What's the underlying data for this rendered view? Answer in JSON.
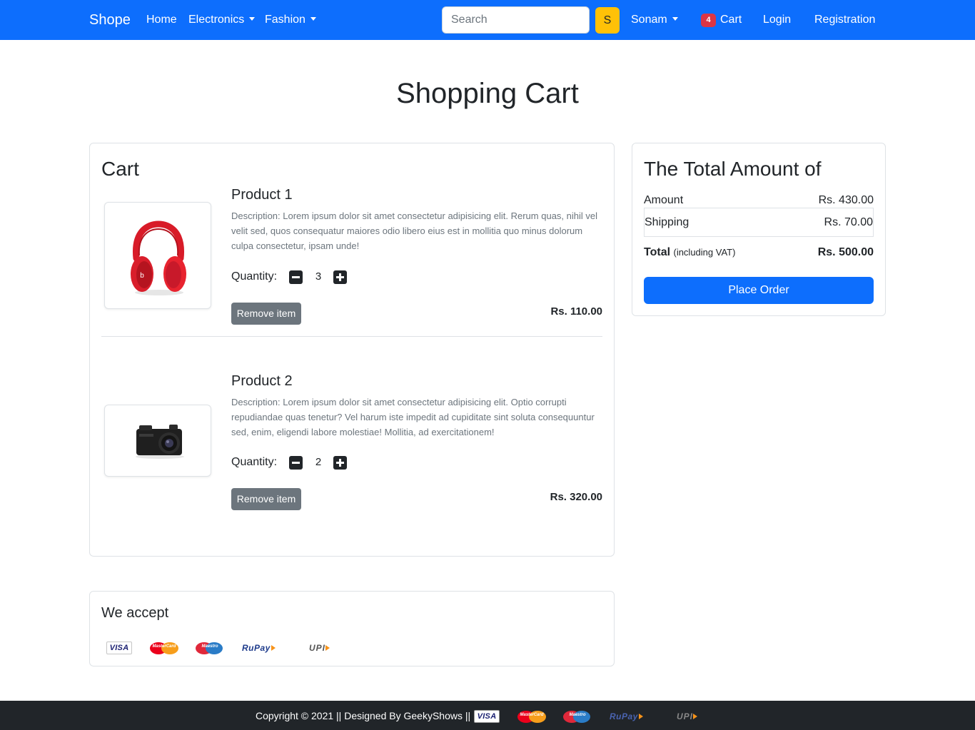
{
  "navbar": {
    "brand": "Shope",
    "links": {
      "home": "Home",
      "electronics": "Electronics",
      "fashion": "Fashion"
    },
    "search": {
      "placeholder": "Search",
      "button_label": "S"
    },
    "user": "Sonam",
    "cart": {
      "count": "4",
      "label": "Cart"
    },
    "login": "Login",
    "registration": "Registration"
  },
  "page": {
    "title": "Shopping Cart"
  },
  "cart": {
    "heading": "Cart",
    "quantity_label": "Quantity:",
    "remove_label": "Remove item",
    "items": [
      {
        "title": "Product 1",
        "description": "Description: Lorem ipsum dolor sit amet consectetur adipisicing elit. Rerum quas, nihil vel velit sed, quos consequatur maiores odio libero eius est in mollitia quo minus dolorum culpa consectetur, ipsam unde!",
        "quantity": "3",
        "price": "Rs. 110.00",
        "image": "red-headphones"
      },
      {
        "title": "Product 2",
        "description": "Description: Lorem ipsum dolor sit amet consectetur adipisicing elit. Optio corrupti repudiandae quas tenetur? Vel harum iste impedit ad cupiditate sint soluta consequuntur sed, enim, eligendi labore molestiae! Mollitia, ad exercitationem!",
        "quantity": "2",
        "price": "Rs. 320.00",
        "image": "black-camera"
      }
    ]
  },
  "summary": {
    "heading": "The Total Amount of",
    "amount_label": "Amount",
    "amount_value": "Rs. 430.00",
    "shipping_label": "Shipping",
    "shipping_value": "Rs. 70.00",
    "total_label": "Total",
    "total_note": "(including VAT)",
    "total_value": "Rs. 500.00",
    "place_order": "Place Order"
  },
  "payment": {
    "heading": "We accept",
    "methods": {
      "visa": "VISA",
      "mastercard": "MasterCard",
      "maestro": "Maestro",
      "rupay": "RuPay",
      "upi": "UPI"
    }
  },
  "footer": {
    "text": "Copyright © 2021 || Designed By GeekyShows ||"
  },
  "colors": {
    "primary": "#0d6efd",
    "warning": "#ffc107",
    "danger": "#dc3545",
    "secondary": "#6c757d",
    "dark": "#212529"
  }
}
